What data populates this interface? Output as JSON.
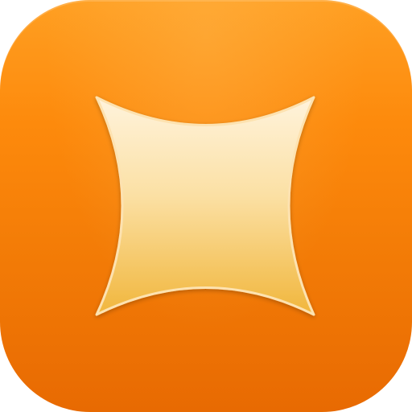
{
  "app_icon": {
    "name": "sparkle-app-icon",
    "icon": "sparkle-star-icon",
    "colors": {
      "background_top": "#ff9f22",
      "background_bottom": "#e86a02",
      "glyph_top": "#fff3dc",
      "glyph_bottom": "#f1b63c",
      "glyph_stroke": "#fde2b0"
    }
  }
}
